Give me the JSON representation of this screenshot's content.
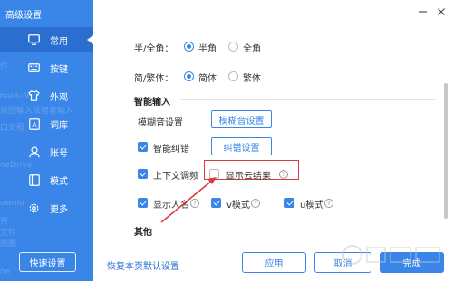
{
  "window": {
    "title": "高级设置"
  },
  "sidebar": {
    "ghost_text": [
      "neDrive",
      "baiduN",
      "返回输入法智能输入",
      "口文程",
      "neDrive",
      "ownlo",
      "开",
      "文件",
      "图图",
      "ne",
      "件"
    ],
    "items": [
      {
        "label": "常用",
        "icon": "monitor-icon",
        "active": true
      },
      {
        "label": "按键",
        "icon": "keyboard-icon",
        "active": false
      },
      {
        "label": "外观",
        "icon": "shirt-icon",
        "active": false
      },
      {
        "label": "词库",
        "icon": "dictionary-icon",
        "active": false
      },
      {
        "label": "账号",
        "icon": "user-icon",
        "active": false
      },
      {
        "label": "模式",
        "icon": "mode-icon",
        "active": false
      },
      {
        "label": "更多",
        "icon": "gear-icon",
        "active": false
      }
    ],
    "quick_settings_label": "快速设置"
  },
  "settings": {
    "width_row": {
      "label": "半/全角：",
      "options": [
        "半角",
        "全角"
      ],
      "selected": "半角"
    },
    "script_row": {
      "label": "简/繁体：",
      "options": [
        "简体",
        "繁体"
      ],
      "selected": "简体"
    },
    "smart_input": {
      "title": "智能输入",
      "fuzzy_label": "模糊音设置",
      "fuzzy_button": "模糊音设置",
      "autocorrect_label": "智能纠错",
      "autocorrect_checked": true,
      "autocorrect_button": "纠错设置",
      "context_label": "上下文调频",
      "context_checked": true,
      "cloud_label": "显示云结果",
      "cloud_checked": false,
      "names_label": "显示人名",
      "names_checked": true,
      "v_mode_label": "v模式",
      "v_mode_checked": true,
      "u_mode_label": "u模式",
      "u_mode_checked": true,
      "help_glyph": "?"
    },
    "other": {
      "title": "其他"
    }
  },
  "footer": {
    "restore_label": "恢复本页默认设置",
    "apply_label": "应用",
    "cancel_label": "取消",
    "done_label": "完成"
  },
  "colors": {
    "accent": "#3a86e8",
    "sidebar": "#3a86e8",
    "annotation": "#e23a3a"
  }
}
